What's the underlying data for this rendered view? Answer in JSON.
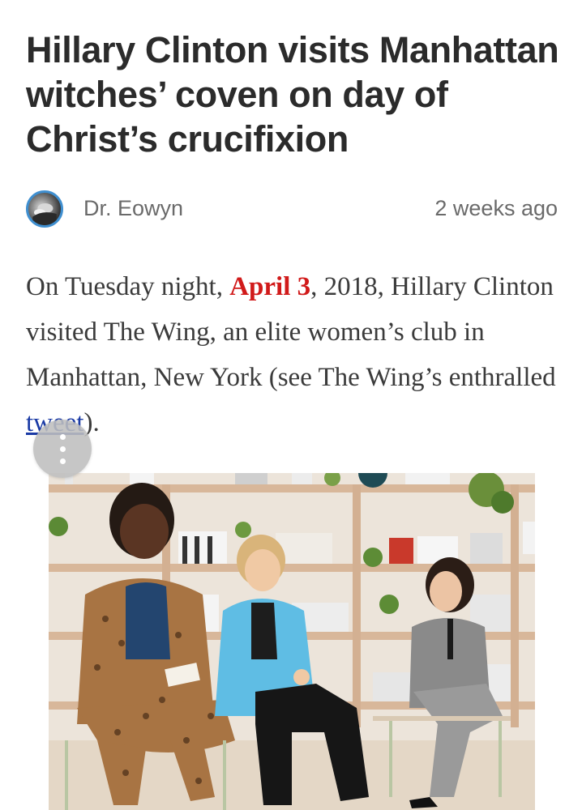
{
  "article": {
    "headline": "Hillary Clinton visits Manhattan witches’ coven on day of Christ’s crucifixion",
    "byline": {
      "author": "Dr. Eowyn",
      "time": "2 weeks ago",
      "avatar_icon": "author-avatar"
    },
    "lede": {
      "part1": "On Tuesday night, ",
      "date_link": "April 3",
      "part2": ", 2018, Hillary Clinton visited The Wing, an elite women’s club in Manhattan, New York (see The Wing’s enthralled ",
      "tweet_link": "tweet",
      "part3": ")."
    },
    "image": {
      "icon": "photo-three-women-seated-on-stage"
    }
  },
  "fab": {
    "icon": "more-vertical-icon"
  },
  "colors": {
    "headline": "#2b2b2b",
    "meta": "#6a6a6a",
    "body": "#3b3b3b",
    "date_link": "#d11a1a",
    "tweet_link": "#1a3aa5",
    "avatar_ring": "#3f8fd0"
  }
}
